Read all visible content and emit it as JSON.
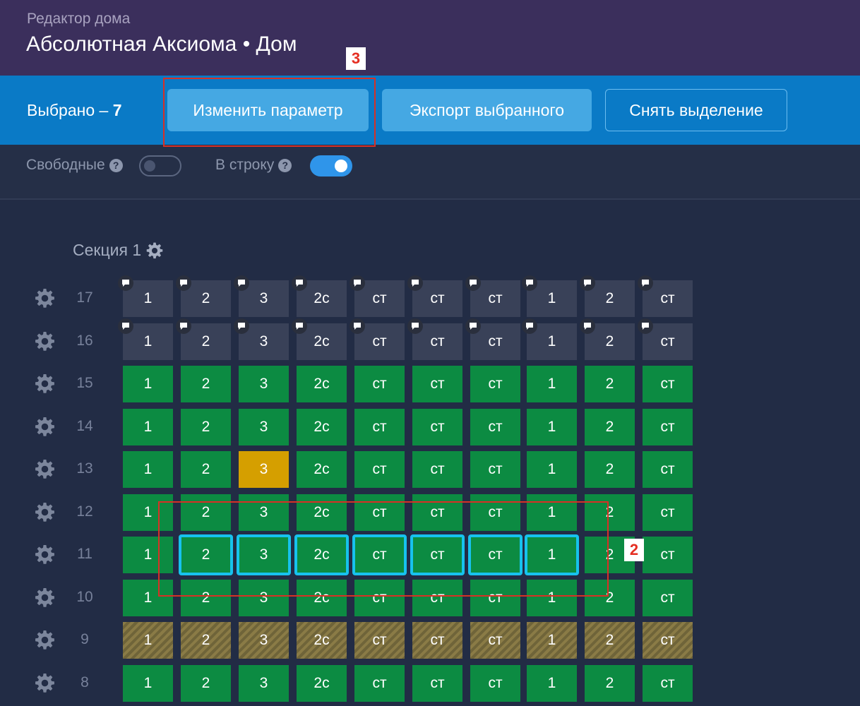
{
  "header": {
    "subtitle": "Редактор дома",
    "title": "Абсолютная Аксиома • Дом"
  },
  "toolbar": {
    "selected_label": "Выбрано – ",
    "selected_count": "7",
    "change_param_label": "Изменить параметр",
    "export_label": "Экспорт выбранного",
    "deselect_label": "Снять выделение"
  },
  "filters": {
    "free_label": "Свободные",
    "free_on": false,
    "inline_label": "В строку",
    "inline_on": true
  },
  "section": {
    "title": "Секция 1"
  },
  "colors": {
    "free": "#0c8b42",
    "inactive": "#394158",
    "reserved": "#d59f00",
    "selected_border": "#17c2ee",
    "annotation": "#d83025"
  },
  "status_legend": {
    "F": "free",
    "I": "inactive",
    "R": "reserved",
    "H": "hatched",
    "S": "selected"
  },
  "grid": {
    "columns": [
      "1",
      "2",
      "3",
      "2с",
      "ст",
      "ст",
      "ст",
      "1",
      "2",
      "ст"
    ],
    "rows": [
      {
        "floor": "17",
        "statuses": "IIIIIIIIII",
        "comments": true
      },
      {
        "floor": "16",
        "statuses": "IIIIIIIIII",
        "comments": true
      },
      {
        "floor": "15",
        "statuses": "FFFFFFFFFF",
        "comments": false
      },
      {
        "floor": "14",
        "statuses": "FFFFFFFFFF",
        "comments": false
      },
      {
        "floor": "13",
        "statuses": "FFRFFFFFFF",
        "comments": false
      },
      {
        "floor": "12",
        "statuses": "FFFFFFFFFF",
        "comments": false
      },
      {
        "floor": "11",
        "statuses": "FSSSSSSSFF",
        "comments": false
      },
      {
        "floor": "10",
        "statuses": "FFFFFFFFFF",
        "comments": false
      },
      {
        "floor": "9",
        "statuses": "HHHHHHHHHH",
        "comments": false
      },
      {
        "floor": "8",
        "statuses": "FFFFFFFFFF",
        "comments": false
      }
    ]
  },
  "annotations": [
    {
      "label": "3",
      "target": "change-param-button"
    },
    {
      "label": "2",
      "target": "selected-row-11"
    }
  ]
}
